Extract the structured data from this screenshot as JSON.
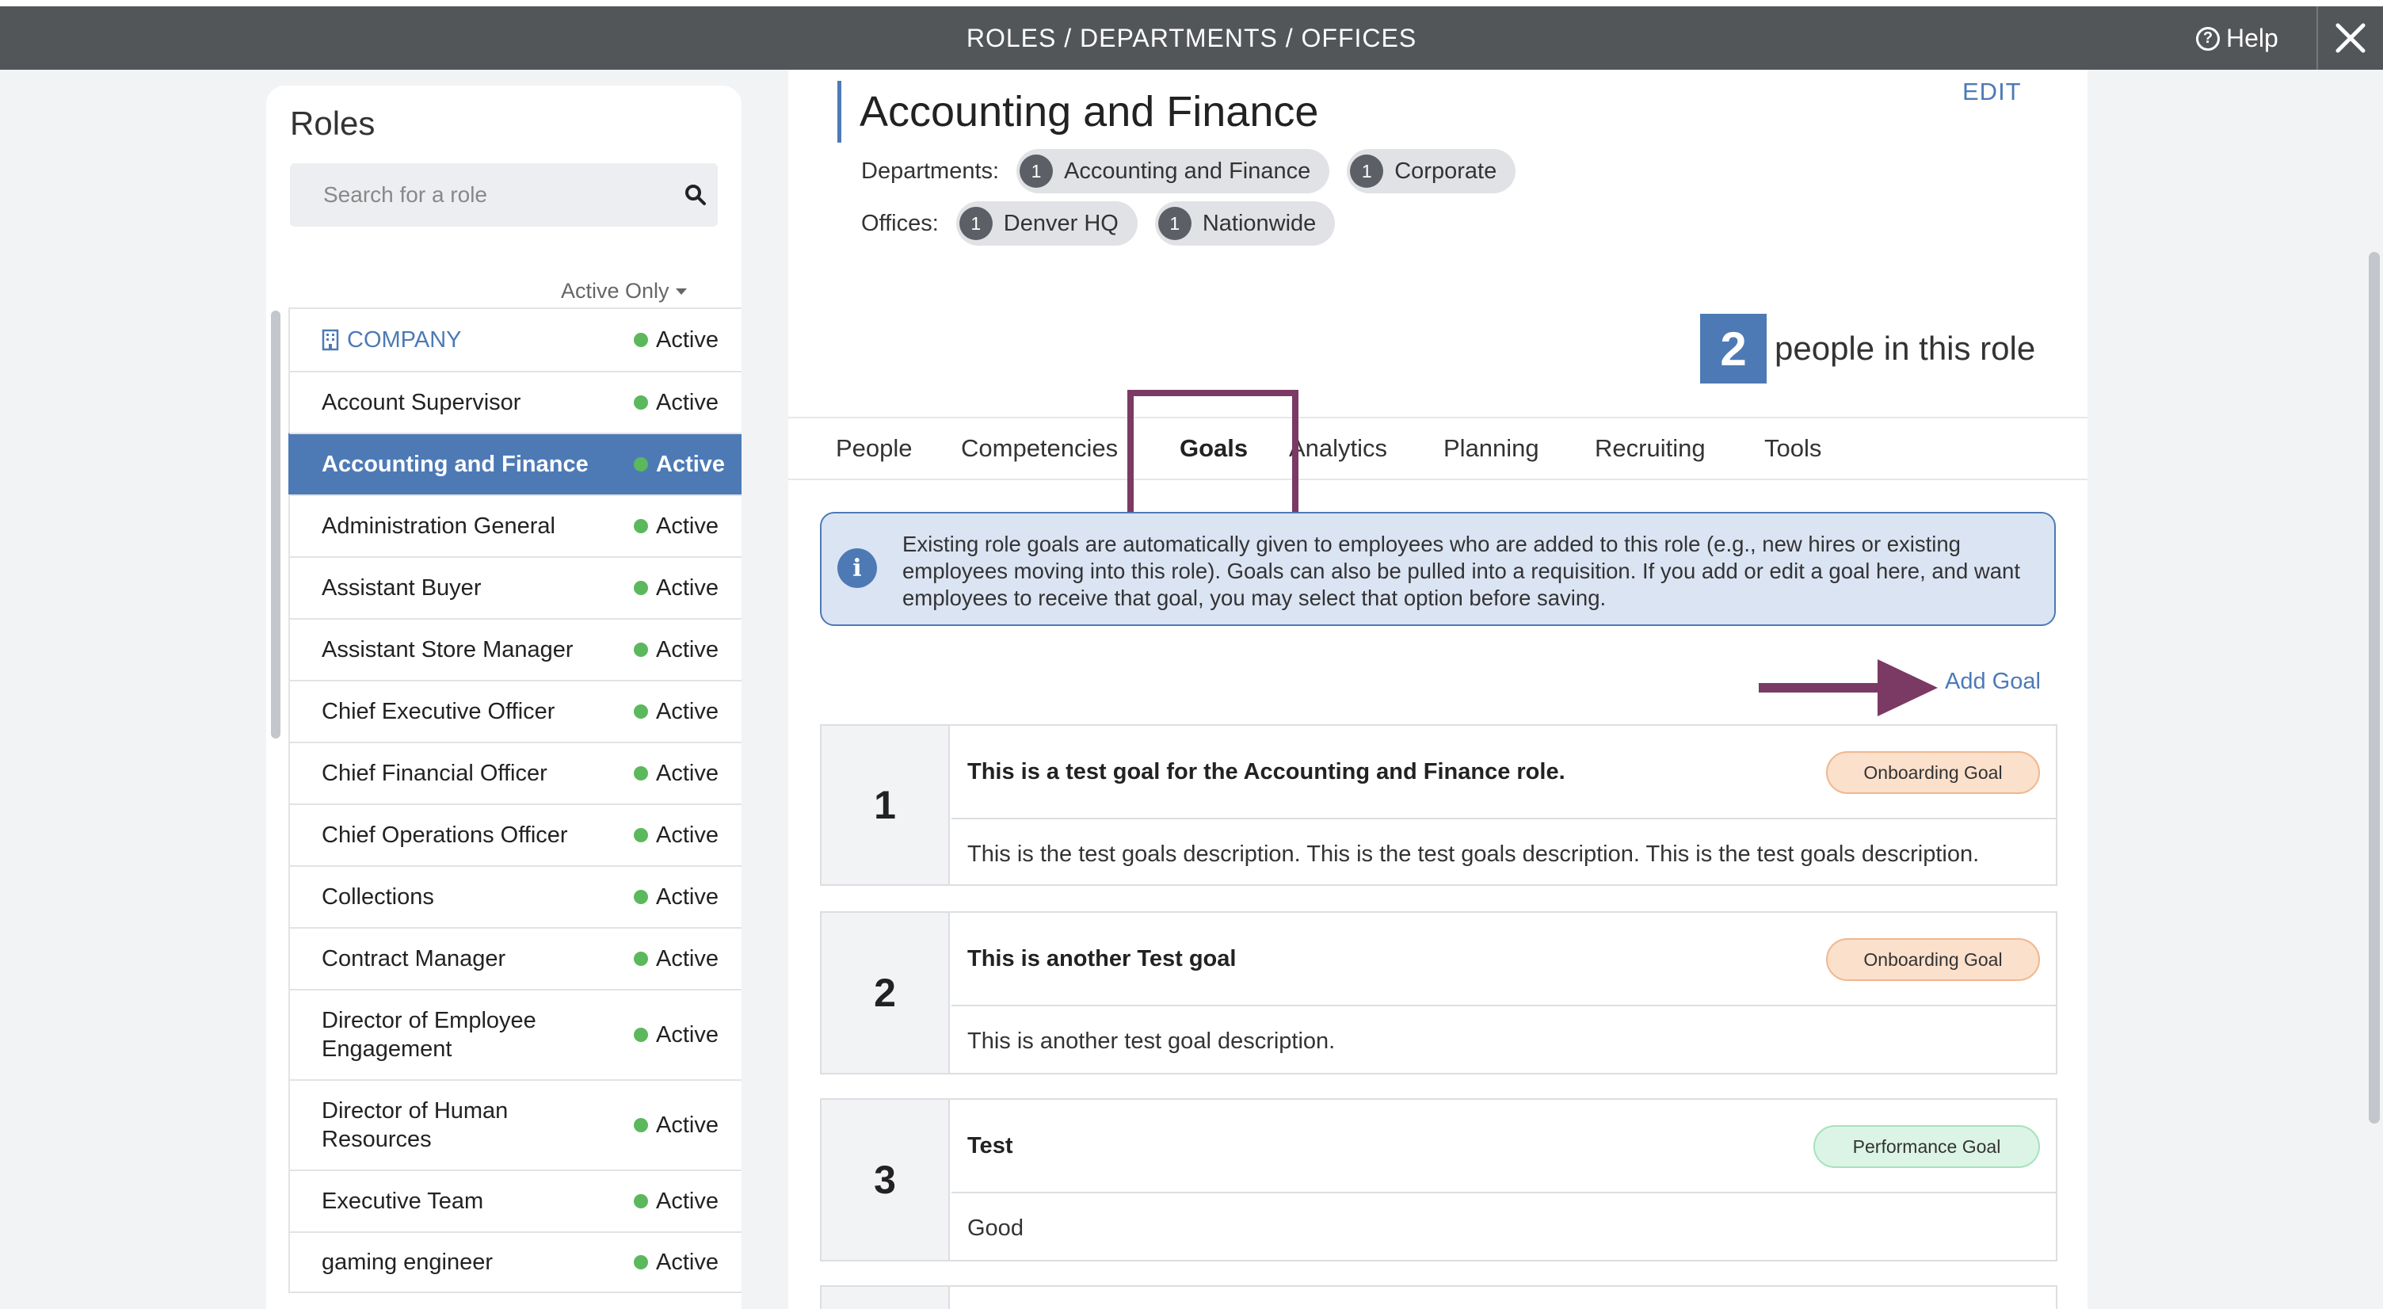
{
  "header": {
    "title": "ROLES / DEPARTMENTS / OFFICES",
    "help_label": "Help"
  },
  "sidebar": {
    "title": "Roles",
    "search_placeholder": "Search for a role",
    "filter_label": "Active Only",
    "roles": [
      {
        "name": "COMPANY",
        "status": "Active"
      },
      {
        "name": "Account Supervisor",
        "status": "Active"
      },
      {
        "name": "Accounting and Finance",
        "status": "Active"
      },
      {
        "name": "Administration General",
        "status": "Active"
      },
      {
        "name": "Assistant Buyer",
        "status": "Active"
      },
      {
        "name": "Assistant Store Manager",
        "status": "Active"
      },
      {
        "name": "Chief Executive Officer",
        "status": "Active"
      },
      {
        "name": "Chief Financial Officer",
        "status": "Active"
      },
      {
        "name": "Chief Operations Officer",
        "status": "Active"
      },
      {
        "name": "Collections",
        "status": "Active"
      },
      {
        "name": "Contract Manager",
        "status": "Active"
      },
      {
        "name": "Director of Employee Engagement",
        "status": "Active"
      },
      {
        "name": "Director of Human Resources",
        "status": "Active"
      },
      {
        "name": "Executive Team",
        "status": "Active"
      },
      {
        "name": "gaming engineer",
        "status": "Active"
      }
    ]
  },
  "main": {
    "role_title": "Accounting and Finance",
    "edit_label": "EDIT",
    "departments_label": "Departments:",
    "departments": [
      {
        "count": "1",
        "name": "Accounting and Finance"
      },
      {
        "count": "1",
        "name": "Corporate"
      }
    ],
    "offices_label": "Offices:",
    "offices": [
      {
        "count": "1",
        "name": "Denver HQ"
      },
      {
        "count": "1",
        "name": "Nationwide"
      }
    ],
    "people_count": "2",
    "people_label": "people in this role",
    "tabs": [
      "People",
      "Competencies",
      "Goals",
      "Analytics",
      "Planning",
      "Recruiting",
      "Tools"
    ],
    "active_tab": "Goals",
    "info_text": "Existing role goals are automatically given to employees who are added to this role (e.g., new hires or existing employees moving into this role). Goals can also be pulled into a requisition. If you add or edit a goal here, and want employees to receive that goal, you may select that option before saving.",
    "add_goal_label": "Add Goal",
    "goals": [
      {
        "number": "1",
        "title": "This is a test goal for the Accounting and Finance role.",
        "type": "Onboarding Goal",
        "description": "This is the test goals description. This is the test goals description. This is the test goals description."
      },
      {
        "number": "2",
        "title": "This is another Test goal",
        "type": "Onboarding Goal",
        "description": "This is another test goal description."
      },
      {
        "number": "3",
        "title": "Test",
        "type": "Performance Goal",
        "description": "Good"
      }
    ]
  },
  "colors": {
    "accent": "#4d7ab5",
    "highlight": "#7a3a63",
    "topbar": "#535659",
    "active_dot": "#5cb85c"
  }
}
